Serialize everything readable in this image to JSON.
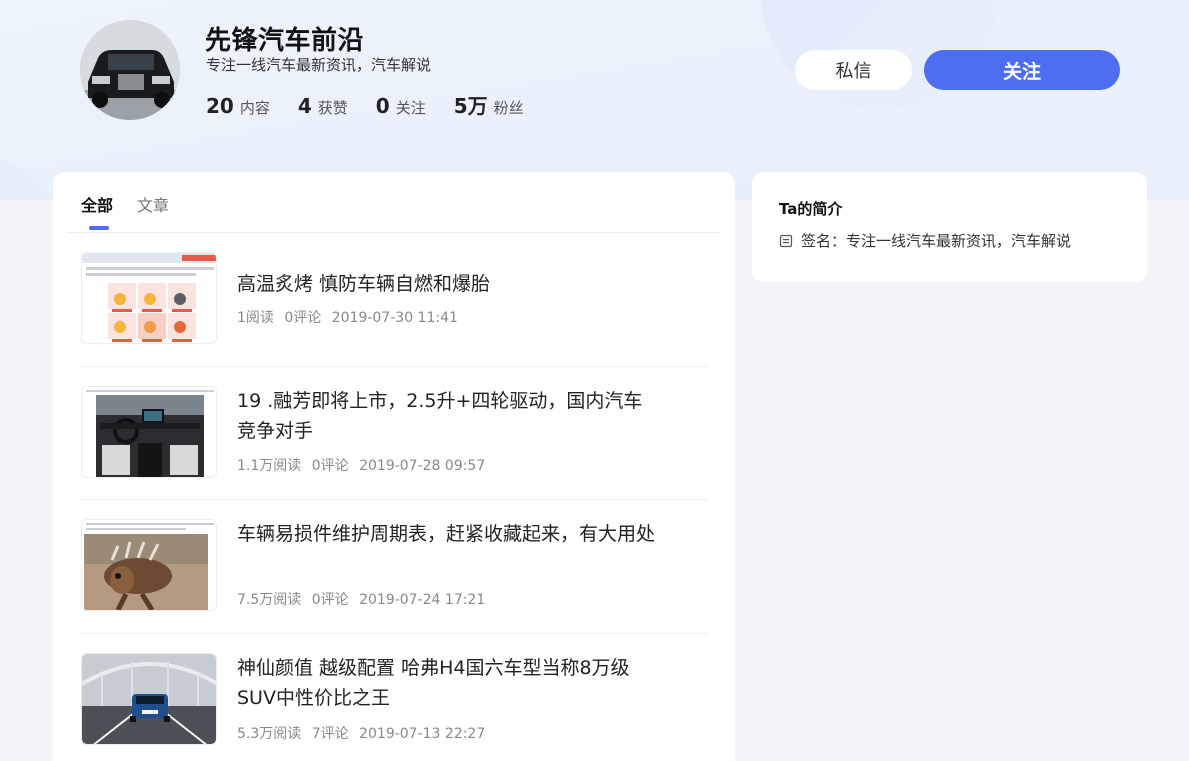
{
  "profile": {
    "name": "先锋汽车前沿",
    "signature": "专注一线汽车最新资讯，汽车解说",
    "stats": [
      {
        "num": "20",
        "label": "内容"
      },
      {
        "num": "4",
        "label": "获赞"
      },
      {
        "num": "0",
        "label": "关注"
      },
      {
        "num": "5万",
        "label": "粉丝"
      }
    ]
  },
  "actions": {
    "message_label": "私信",
    "follow_label": "关注"
  },
  "tabs": [
    {
      "label": "全部",
      "active": true
    },
    {
      "label": "文章",
      "active": false
    }
  ],
  "articles": [
    {
      "title": "高温炙烤 慎防车辆自燃和爆胎",
      "reads": "1阅读",
      "comments": "0评论",
      "date": "2019-07-30 11:41"
    },
    {
      "title": "19 .融芳即将上市，2.5升+四轮驱动，国内汽车竞争对手",
      "reads": "1.1万阅读",
      "comments": "0评论",
      "date": "2019-07-28 09:57"
    },
    {
      "title": "车辆易损件维护周期表，赶紧收藏起来，有大用处",
      "reads": "7.5万阅读",
      "comments": "0评论",
      "date": "2019-07-24 17:21"
    },
    {
      "title": "神仙颜值 越级配置 哈弗H4国六车型当称8万级SUV中性价比之王",
      "reads": "5.3万阅读",
      "comments": "7评论",
      "date": "2019-07-13 22:27"
    }
  ],
  "sidebar": {
    "title": "Ta的简介",
    "signature": "签名：专注一线汽车最新资讯，汽车解说"
  },
  "colors": {
    "accent": "#4e6ef2",
    "page_bg": "#f3f5f8"
  }
}
